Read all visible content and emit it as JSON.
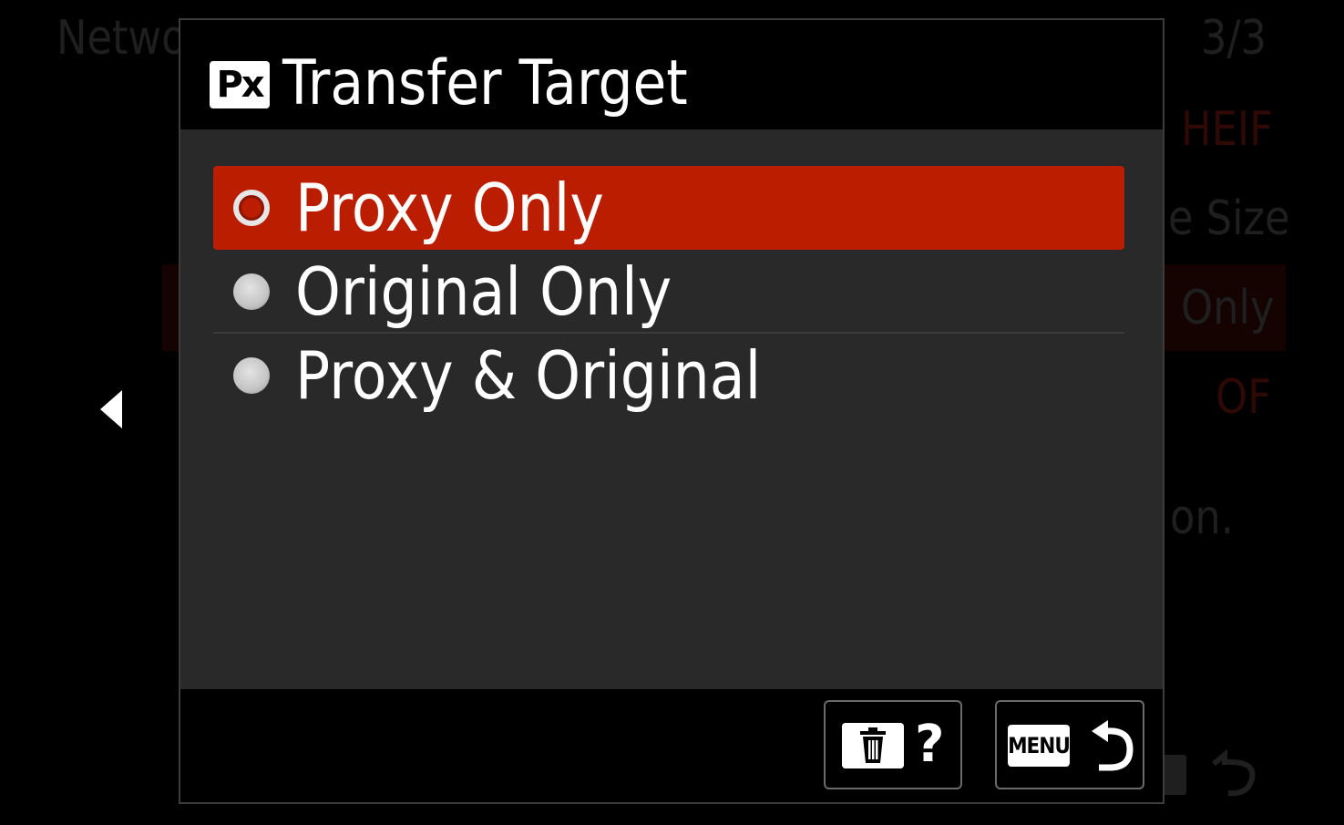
{
  "background": {
    "header_left": "Netwo",
    "page_indicator": "3/3",
    "right_items": [
      "HEIF",
      "e Size",
      "Only",
      "OF",
      "on."
    ]
  },
  "dialog": {
    "badge": "Px",
    "title": "Transfer Target",
    "options": [
      {
        "label": "Proxy Only",
        "selected": true
      },
      {
        "label": "Original Only",
        "selected": false
      },
      {
        "label": "Proxy & Original",
        "selected": false
      }
    ],
    "footer": {
      "help_label": "?",
      "menu_label": "MENU"
    }
  },
  "icons": {
    "badge": "px-badge-icon",
    "radio_selected": "radio-selected-icon",
    "radio": "radio-icon",
    "trash": "trash-icon",
    "return": "return-icon",
    "left_arrow": "left-arrow-icon"
  },
  "colors": {
    "selection": "#bb1d00",
    "dialog_bg": "#292929",
    "header_bg": "#000000",
    "text": "#ffffff"
  }
}
